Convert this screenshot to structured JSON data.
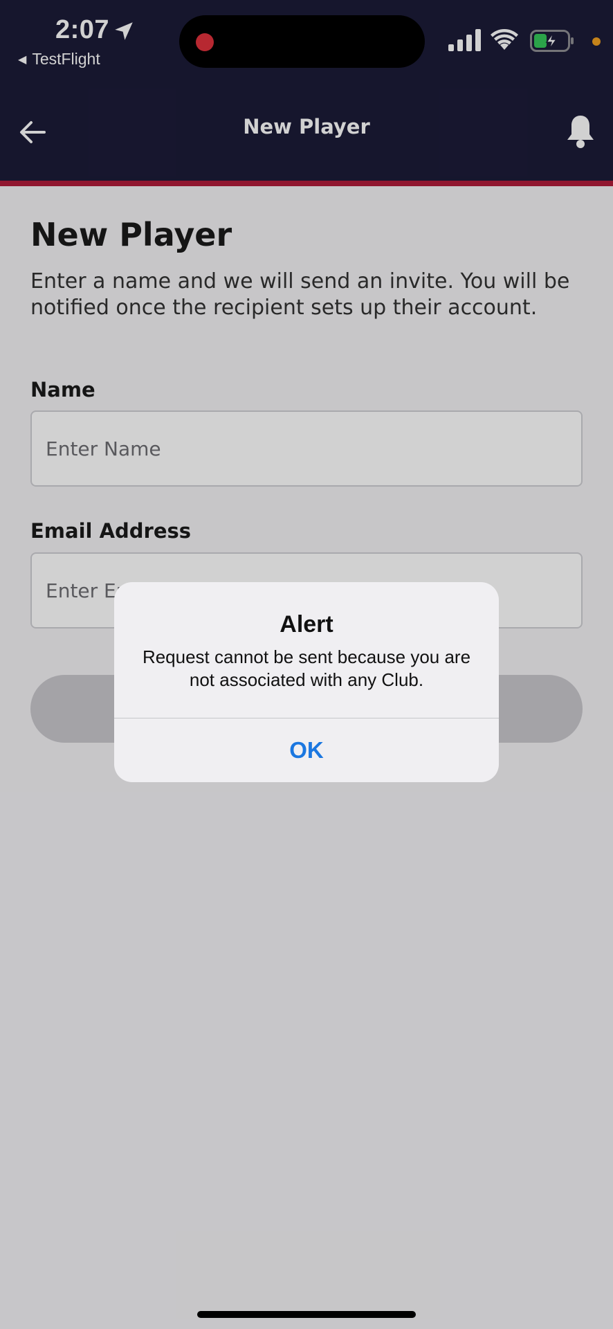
{
  "status_bar": {
    "time": "2:07",
    "back_app": "TestFlight"
  },
  "nav": {
    "title": "New Player"
  },
  "form": {
    "heading": "New Player",
    "description": "Enter a name and we will send an invite. You will be notified once the recipient sets up their account.",
    "name_label": "Name",
    "name_placeholder": "Enter Name",
    "name_value": "",
    "email_label": "Email Address",
    "email_placeholder": "Enter Email",
    "email_value": ""
  },
  "alert": {
    "title": "Alert",
    "message": "Request cannot be sent because you are not associated with any Club.",
    "ok_label": "OK"
  },
  "colors": {
    "header_bg": "#1c1b38",
    "header_stripe": "#b01b3a",
    "alert_button": "#1b77e0"
  },
  "icons": [
    "location-arrow-icon",
    "signal-icon",
    "wifi-icon",
    "battery-charging-icon",
    "back-arrow-icon",
    "bell-icon"
  ]
}
